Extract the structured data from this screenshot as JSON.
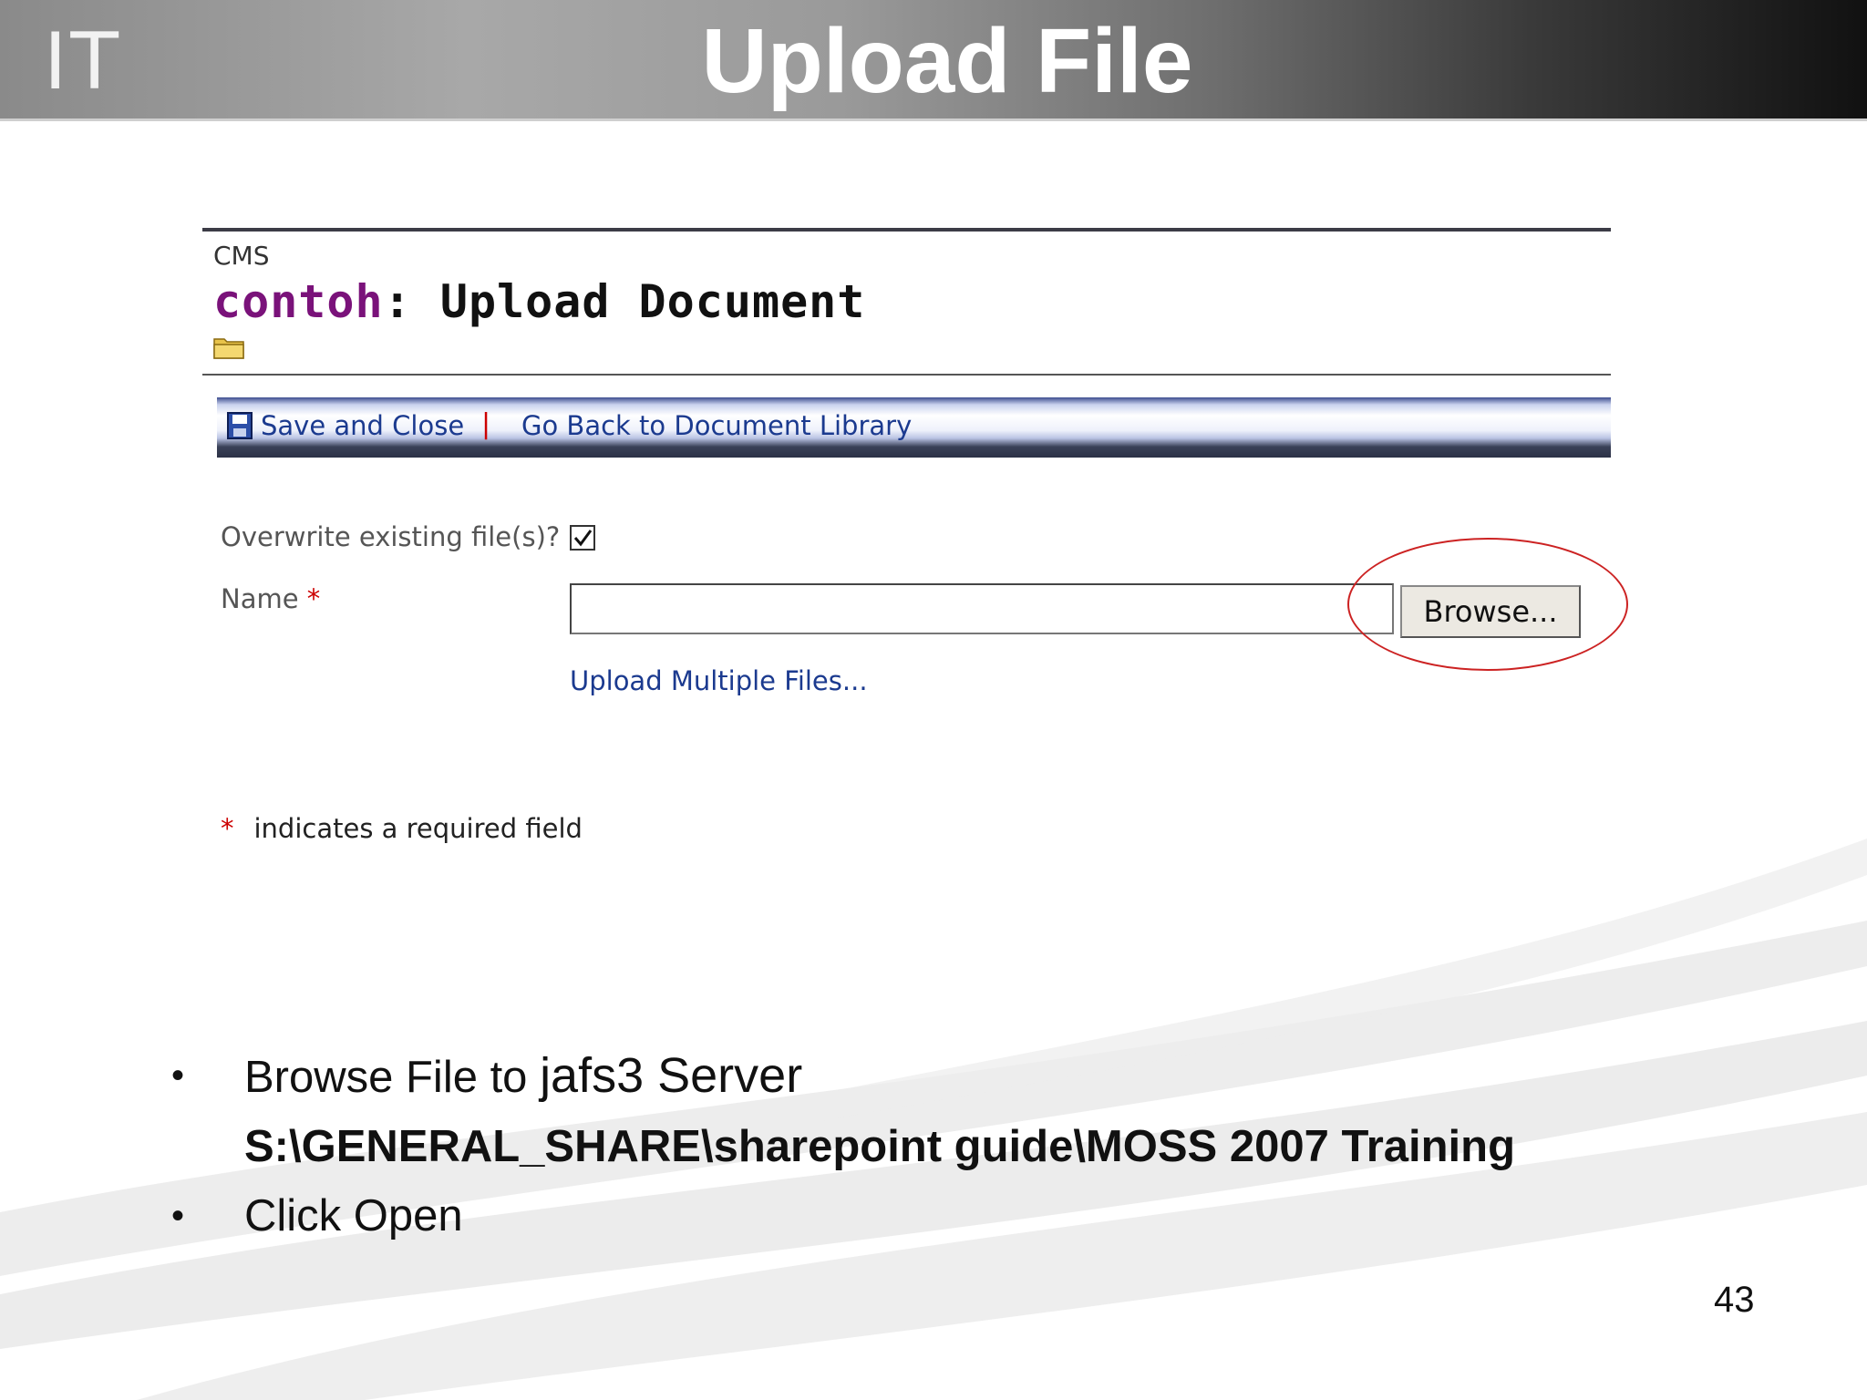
{
  "header": {
    "logo": "IT",
    "title": "Upload File"
  },
  "panel": {
    "site_name": "CMS",
    "heading_site": "contoh",
    "heading_separator": ": ",
    "heading_rest": "Upload Document",
    "toolbar": {
      "save_close": "Save and Close",
      "separator": "|",
      "go_back": "Go Back to Document Library"
    },
    "form": {
      "overwrite_label": "Overwrite existing file(s)?",
      "overwrite_checked": true,
      "name_label": "Name",
      "required_mark": "*",
      "name_value": "",
      "browse_label": "Browse...",
      "upload_multiple": "Upload Multiple Files..."
    },
    "required_note": "indicates a required field"
  },
  "bullets": {
    "b1_prefix": "Browse File to ",
    "b1_server": "jafs3 Server",
    "path": "S:\\GENERAL_SHARE\\sharepoint guide\\MOSS 2007 Training",
    "b2": "Click Open"
  },
  "page_number": "43",
  "colors": {
    "site_purple": "#7a127a",
    "link_blue": "#1b3a8f",
    "required_red": "#cc0000",
    "ring_red": "#cc2222"
  }
}
